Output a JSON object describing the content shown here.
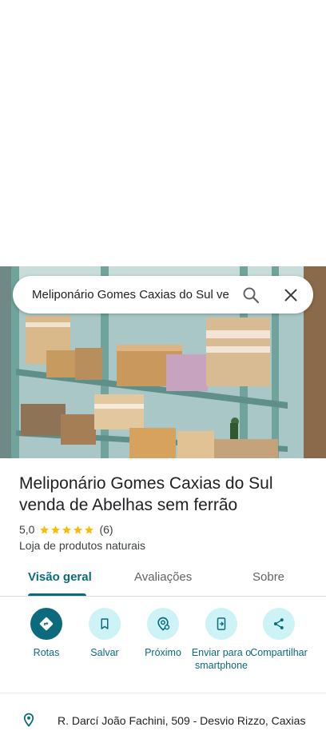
{
  "search": {
    "query": "Meliponário Gomes Caxias do Sul ve"
  },
  "place": {
    "name": "Meliponário Gomes Caxias do Sul venda de Abelhas sem ferrão",
    "rating": "5,0",
    "review_count": "(6)",
    "stars": 5,
    "category": "Loja de produtos naturais",
    "address": "R. Darcí João Fachini, 509 - Desvio Rizzo, Caxias"
  },
  "tabs": [
    {
      "label": "Visão geral",
      "active": true
    },
    {
      "label": "Avaliações",
      "active": false
    },
    {
      "label": "Sobre",
      "active": false
    }
  ],
  "actions": [
    {
      "label": "Rotas",
      "icon": "directions-icon"
    },
    {
      "label": "Salvar",
      "icon": "bookmark-icon"
    },
    {
      "label": "Próximo",
      "icon": "nearby-icon"
    },
    {
      "label": "Enviar para o smartphone",
      "icon": "send-to-phone-icon"
    },
    {
      "label": "Compartilhar",
      "icon": "share-icon"
    }
  ],
  "colors": {
    "accent": "#0b6b7c",
    "action_bg": "#cdf3f6",
    "star": "#fbbc04"
  }
}
